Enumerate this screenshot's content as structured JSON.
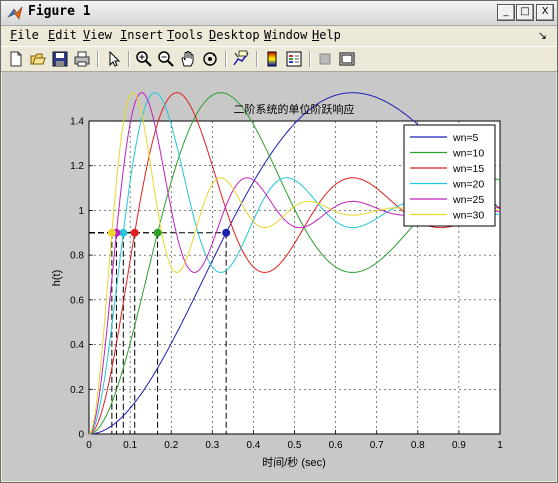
{
  "window": {
    "title": "Figure 1",
    "controls": {
      "minimize": "_",
      "maximize": "□",
      "close": "X"
    }
  },
  "menu": {
    "items": [
      {
        "first": "F",
        "rest": "ile"
      },
      {
        "first": "E",
        "rest": "dit"
      },
      {
        "first": "V",
        "rest": "iew"
      },
      {
        "first": "I",
        "rest": "nsert"
      },
      {
        "first": "T",
        "rest": "ools"
      },
      {
        "first": "D",
        "rest": "esktop"
      },
      {
        "first": "W",
        "rest": "indow"
      },
      {
        "first": "H",
        "rest": "elp"
      }
    ],
    "dock_arrow": "↘"
  },
  "toolbar": {
    "icons": [
      "new-figure-icon",
      "open-file-icon",
      "save-icon",
      "print-icon",
      "arrow-pointer-icon",
      "zoom-in-icon",
      "zoom-out-icon",
      "pan-hand-icon",
      "rotate-3d-icon",
      "data-cursor-icon",
      "colorbar-icon",
      "legend-icon",
      "hide-plot-tools-icon",
      "show-plot-tools-icon"
    ]
  },
  "chart_data": {
    "type": "line",
    "title": "二阶系统的单位阶跃响应",
    "xlabel": "时间/秒 (sec)",
    "ylabel": "h(t)",
    "xlim": [
      0,
      1
    ],
    "ylim": [
      0,
      1.4
    ],
    "xticks": [
      "0",
      "0.1",
      "0.2",
      "0.3",
      "0.4",
      "0.5",
      "0.6",
      "0.7",
      "0.8",
      "0.9",
      "1"
    ],
    "yticks": [
      "0",
      "0.2",
      "0.4",
      "0.6",
      "0.8",
      "1",
      "1.2",
      "1.4"
    ],
    "grid": true,
    "legend_position": "top-right",
    "zeta": 0.2,
    "reference_level": 0.9,
    "series": [
      {
        "name": "wn=5",
        "wn": 5,
        "color": "#1f1fb4"
      },
      {
        "name": "wn=10",
        "wn": 10,
        "color": "#2ca02c"
      },
      {
        "name": "wn=15",
        "wn": 15,
        "color": "#e02020"
      },
      {
        "name": "wn=20",
        "wn": 20,
        "color": "#22c8d8"
      },
      {
        "name": "wn=25",
        "wn": 25,
        "color": "#c020c0"
      },
      {
        "name": "wn=30",
        "wn": 30,
        "color": "#e8d82a"
      }
    ]
  }
}
